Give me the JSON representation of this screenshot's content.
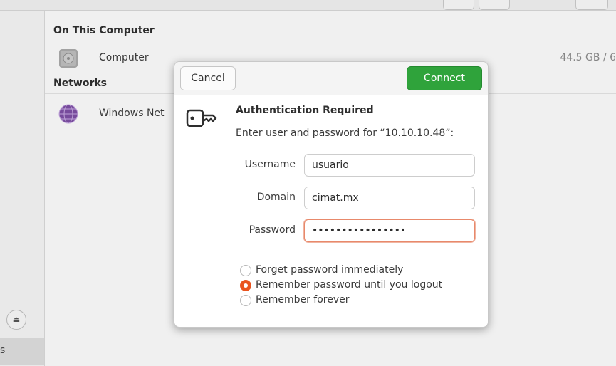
{
  "places": {
    "on_this_computer_header": "On This Computer",
    "computer_label": "Computer",
    "computer_usage": "44.5 GB / 6",
    "networks_header": "Networks",
    "windows_network_label": "Windows Net"
  },
  "sidebar": {
    "selected_fragment": "s",
    "eject_icon": "eject-icon"
  },
  "dialog": {
    "cancel_label": "Cancel",
    "connect_label": "Connect",
    "title": "Authentication Required",
    "message": "Enter user and password for “10.10.10.48”:",
    "icon": "key-icon",
    "fields": {
      "username_label": "Username",
      "username_value": "usuario",
      "domain_label": "Domain",
      "domain_value": "cimat.mx",
      "password_label": "Password",
      "password_value": "aaaaaaaaaaaaaaaa"
    },
    "options": [
      {
        "label": "Forget password immediately",
        "selected": false
      },
      {
        "label": "Remember password until you logout",
        "selected": true
      },
      {
        "label": "Remember forever",
        "selected": false
      }
    ]
  },
  "colors": {
    "connect_button": "#2fa33b",
    "radio_selected": "#e95420",
    "focus_ring": "#e8896b"
  }
}
